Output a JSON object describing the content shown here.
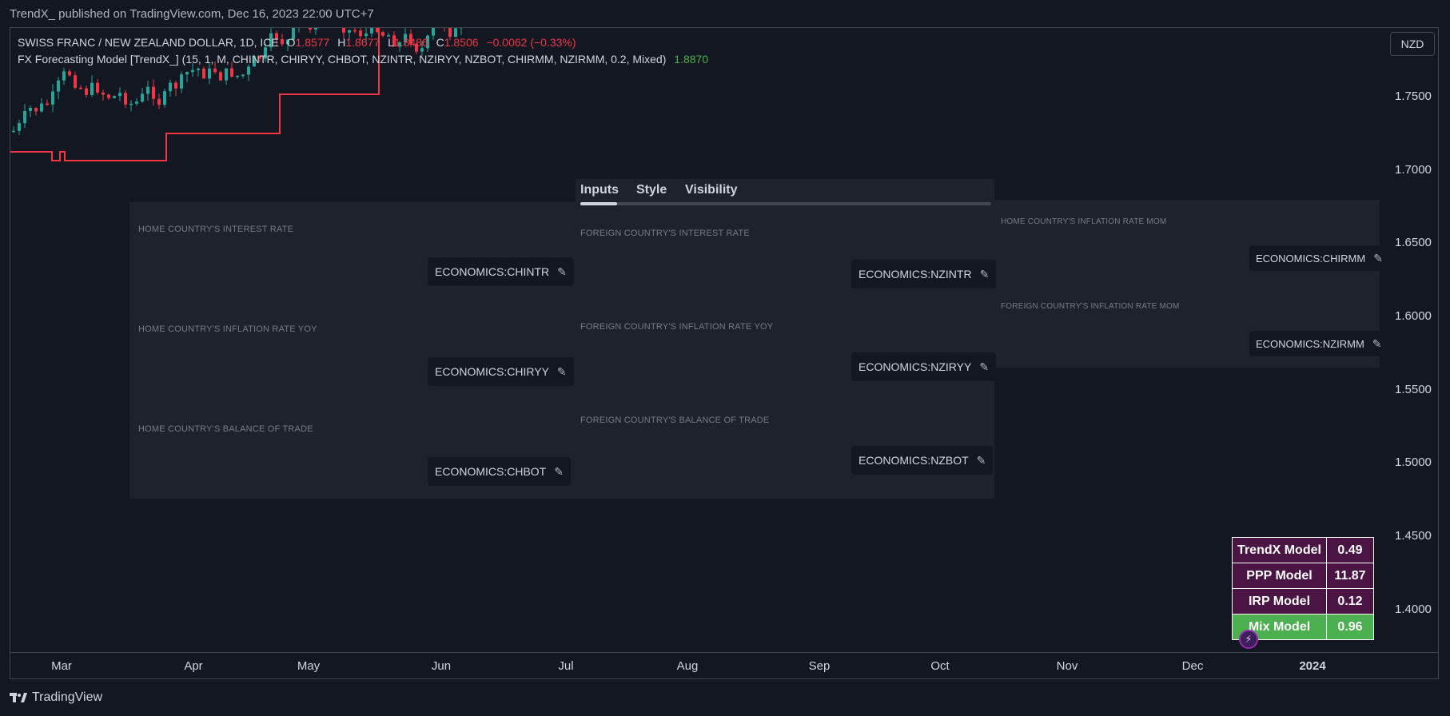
{
  "publisher_line": "TrendX_ published on TradingView.com, Dec 16, 2023 22:00 UTC+7",
  "legend": {
    "symbol": "SWISS FRANC / NEW ZEALAND DOLLAR, 1D, ICE",
    "o_label": "O",
    "o_value": "1.8577",
    "h_label": "H",
    "h_value": "1.8677",
    "l_label": "L",
    "l_value": "1.8486",
    "c_label": "C",
    "c_value": "1.8506",
    "change": "−0.0062 (−0.33%)",
    "indicator": "FX Forecasting Model [TrendX_] (15, 1, M, CHINTR, CHIRYY, CHBOT, NZINTR, NZIRYY, NZBOT, CHIRMM, NZIRMM, 0.2, Mixed)",
    "indicator_value": "1.8870"
  },
  "currency_button": "NZD",
  "price_axis": [
    "1.7500",
    "1.7000",
    "1.6500",
    "1.6000",
    "1.5500",
    "1.5000",
    "1.4500",
    "1.4000"
  ],
  "time_axis": [
    "Mar",
    "Apr",
    "May",
    "Jun",
    "Jul",
    "Aug",
    "Sep",
    "Oct",
    "Nov",
    "Dec",
    "2024"
  ],
  "brand": "TradingView",
  "dialog": {
    "tabs": [
      "Inputs",
      "Style",
      "Visibility"
    ],
    "active_tab": "Inputs",
    "home_fields": [
      {
        "label": "HOME COUNTRY'S INTEREST RATE",
        "value": "ECONOMICS:CHINTR"
      },
      {
        "label": "HOME COUNTRY'S INFLATION RATE YOY",
        "value": "ECONOMICS:CHIRYY"
      },
      {
        "label": "HOME COUNTRY'S BALANCE OF TRADE",
        "value": "ECONOMICS:CHBOT"
      }
    ],
    "foreign_fields": [
      {
        "label": "FOREIGN COUNTRY'S INTEREST RATE",
        "value": "ECONOMICS:NZINTR"
      },
      {
        "label": "FOREIGN COUNTRY'S INFLATION RATE YOY",
        "value": "ECONOMICS:NZIRYY"
      },
      {
        "label": "FOREIGN COUNTRY'S BALANCE OF TRADE",
        "value": "ECONOMICS:NZBOT"
      }
    ],
    "mom_fields": [
      {
        "label": "HOME COUNTRY'S INFLATION RATE MOM",
        "value": "ECONOMICS:CHIRMM"
      },
      {
        "label": "FOREIGN COUNTRY'S INFLATION RATE MOM",
        "value": "ECONOMICS:NZIRMM"
      }
    ]
  },
  "models": [
    {
      "name": "TrendX Model",
      "value": "0.49"
    },
    {
      "name": "PPP Model",
      "value": "11.87"
    },
    {
      "name": "IRP Model",
      "value": "0.12"
    },
    {
      "name": "Mix Model",
      "value": "0.96"
    }
  ],
  "colors": {
    "background": "#131722",
    "panel": "#1e222d",
    "bull": "#26a69a",
    "bear": "#f23645",
    "indicator_line": "#f23645",
    "model_row": "#4a1545",
    "mix_row": "#4caf50"
  }
}
